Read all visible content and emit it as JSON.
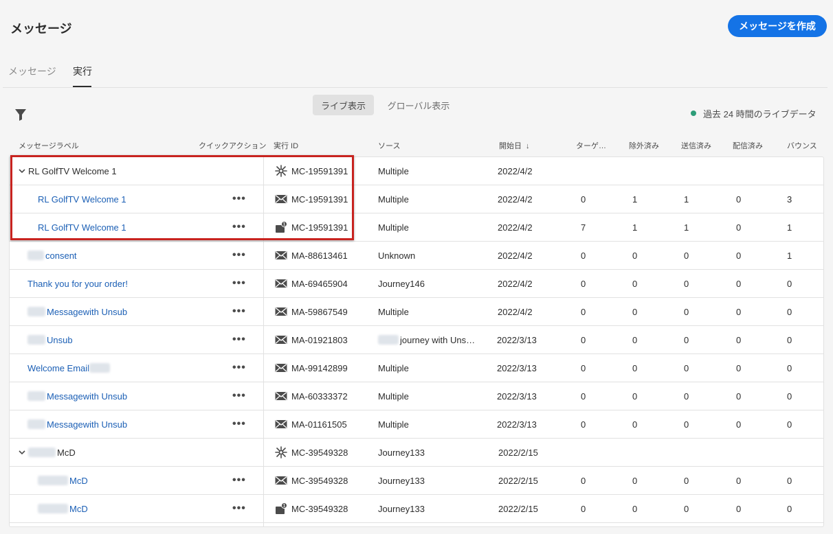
{
  "header": {
    "title": "メッセージ",
    "create_label": "メッセージを作成"
  },
  "tabs": [
    {
      "label": "メッセージ"
    },
    {
      "label": "実行"
    }
  ],
  "view": {
    "live_label": "ライブ表示",
    "global_label": "グローバル表示",
    "live_status": "過去 24 時間のライブデータ"
  },
  "columns": {
    "label": "メッセージラベル",
    "quick_action": "クイックアクション",
    "run_id": "実行 ID",
    "source": "ソース",
    "start_date": "開始日",
    "target": "ターゲ…",
    "excluded": "除外済み",
    "sent": "送信済み",
    "delivered": "配信済み",
    "bounce": "バウンス"
  },
  "icons": {
    "filter": "filter-icon",
    "sort": "arrow-down-icon",
    "journey": "journey-icon",
    "email": "email-icon",
    "push": "push-notification-icon",
    "more": "more-icon",
    "chevron": "chevron-down-icon"
  },
  "rows": [
    {
      "label": "RL GolfTV Welcome 1",
      "run_id": "MC-19591391",
      "source": "Multiple",
      "date": "2022/4/2",
      "target": "",
      "excluded": "",
      "sent": "",
      "delivered": "",
      "bounce": ""
    },
    {
      "label": "RL GolfTV Welcome 1",
      "run_id": "MC-19591391",
      "source": "Multiple",
      "date": "2022/4/2",
      "target": "0",
      "excluded": "1",
      "sent": "1",
      "delivered": "0",
      "bounce": "3"
    },
    {
      "label": "RL GolfTV Welcome 1",
      "run_id": "MC-19591391",
      "source": "Multiple",
      "date": "2022/4/2",
      "target": "7",
      "excluded": "1",
      "sent": "1",
      "delivered": "0",
      "bounce": "1"
    },
    {
      "label": "consent",
      "run_id": "MA-88613461",
      "source": "Unknown",
      "date": "2022/4/2",
      "target": "0",
      "excluded": "0",
      "sent": "0",
      "delivered": "0",
      "bounce": "1"
    },
    {
      "label": "Thank you for your order!",
      "run_id": "MA-69465904",
      "source": "Journey146",
      "date": "2022/4/2",
      "target": "0",
      "excluded": "0",
      "sent": "0",
      "delivered": "0",
      "bounce": "0"
    },
    {
      "label": "Messagewith Unsub",
      "run_id": "MA-59867549",
      "source": "Multiple",
      "date": "2022/4/2",
      "target": "0",
      "excluded": "0",
      "sent": "0",
      "delivered": "0",
      "bounce": "0"
    },
    {
      "label": "Unsub",
      "run_id": "MA-01921803",
      "source": "journey with Uns…",
      "date": "2022/3/13",
      "target": "0",
      "excluded": "0",
      "sent": "0",
      "delivered": "0",
      "bounce": "0"
    },
    {
      "label": "Welcome Email",
      "run_id": "MA-99142899",
      "source": "Multiple",
      "date": "2022/3/13",
      "target": "0",
      "excluded": "0",
      "sent": "0",
      "delivered": "0",
      "bounce": "0"
    },
    {
      "label": "Messagewith Unsub",
      "run_id": "MA-60333372",
      "source": "Multiple",
      "date": "2022/3/13",
      "target": "0",
      "excluded": "0",
      "sent": "0",
      "delivered": "0",
      "bounce": "0"
    },
    {
      "label": "Messagewith Unsub",
      "run_id": "MA-01161505",
      "source": "Multiple",
      "date": "2022/3/13",
      "target": "0",
      "excluded": "0",
      "sent": "0",
      "delivered": "0",
      "bounce": "0"
    },
    {
      "label": "McD",
      "run_id": "MC-39549328",
      "source": "Journey133",
      "date": "2022/2/15",
      "target": "",
      "excluded": "",
      "sent": "",
      "delivered": "",
      "bounce": ""
    },
    {
      "label": "McD",
      "run_id": "MC-39549328",
      "source": "Journey133",
      "date": "2022/2/15",
      "target": "0",
      "excluded": "0",
      "sent": "0",
      "delivered": "0",
      "bounce": "0"
    },
    {
      "label": "McD",
      "run_id": "MC-39549328",
      "source": "Journey133",
      "date": "2022/2/15",
      "target": "0",
      "excluded": "0",
      "sent": "0",
      "delivered": "0",
      "bounce": "0"
    }
  ]
}
